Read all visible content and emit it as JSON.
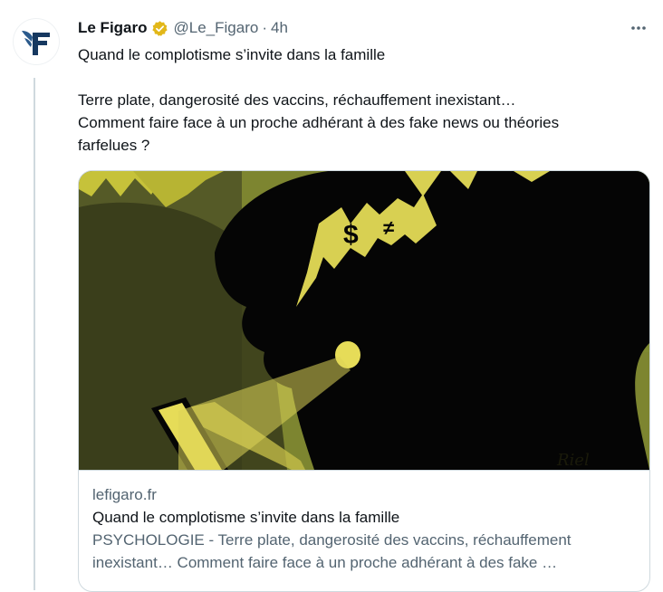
{
  "tweet": {
    "author_name": "Le Figaro",
    "handle": "@Le_Figaro",
    "separator": "·",
    "time": "4h",
    "text_lines": [
      "Quand le complotisme s’invite dans la famille",
      "Terre plate, dangerosité des vaccins, réchauffement inexistant…",
      "Comment faire face à un proche adhérant à des fake news ou théories",
      "farfelues ?"
    ],
    "verified_badge_color": "#e2b719",
    "avatar_icon": "le-figaro-logo"
  },
  "card": {
    "image_icon": "silhouette-illustration",
    "image_signature": "Riel",
    "domain": "lefigaro.fr",
    "title": "Quand le complotisme s’invite dans la famille",
    "description_line1": "PSYCHOLOGIE - Terre plate, dangerosité des vaccins, réchauffement",
    "description_line2": "inexistant… Comment faire face à un proche adhérant à des fake …"
  },
  "colors": {
    "text": "#0f1419",
    "secondary": "#536471",
    "border": "#cfd9de",
    "brand_blue": "#163860"
  }
}
